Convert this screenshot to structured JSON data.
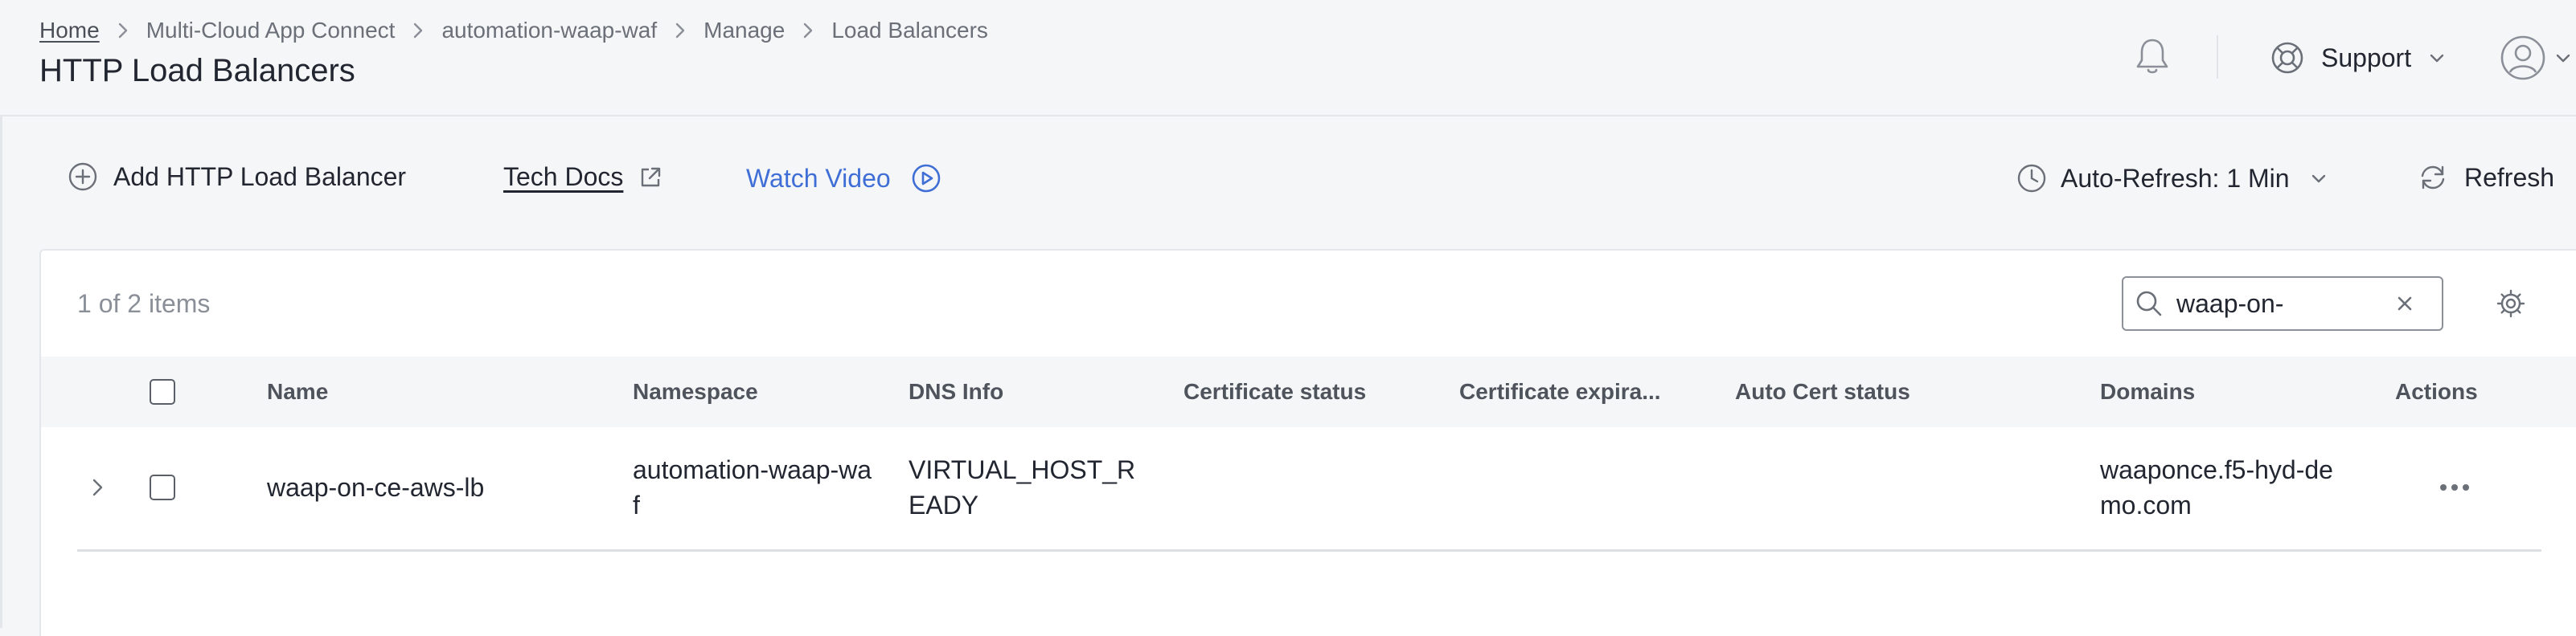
{
  "breadcrumb": {
    "items": [
      "Home",
      "Multi-Cloud App Connect",
      "automation-waap-waf",
      "Manage",
      "Load Balancers"
    ]
  },
  "page": {
    "title": "HTTP Load Balancers"
  },
  "header": {
    "support_label": "Support"
  },
  "toolbar": {
    "add_label": "Add HTTP Load Balancer",
    "tech_docs_label": "Tech Docs",
    "watch_video_label": "Watch Video",
    "auto_refresh_label": "Auto-Refresh: 1 Min",
    "refresh_label": "Refresh"
  },
  "table": {
    "count_text": "1 of 2 items",
    "search_value": "waap-on-",
    "columns": [
      "Name",
      "Namespace",
      "DNS Info",
      "Certificate status",
      "Certificate expira...",
      "Auto Cert status",
      "Domains",
      "Actions"
    ],
    "rows": [
      {
        "name": "waap-on-ce-aws-lb",
        "namespace": "automation-waap-waf",
        "dns_info": "VIRTUAL_HOST_READY",
        "certificate_status": "",
        "certificate_expiration": "",
        "auto_cert_status": "",
        "domains": "waaponce.f5-hyd-demo.com"
      }
    ]
  },
  "icons": {
    "bell": "bell-icon",
    "support": "lifebuoy-icon",
    "user": "user-circle-icon",
    "add": "plus-circle-icon",
    "external": "external-link-icon",
    "play": "play-circle-icon",
    "clock": "clock-icon",
    "refresh": "refresh-icon",
    "search": "search-icon",
    "clear": "close-icon",
    "settings": "gear-icon",
    "expand": "chevron-right-icon",
    "actions": "more-horizontal-icon"
  },
  "colors": {
    "accent": "#3f6fd6",
    "background": "#f5f6f8",
    "card": "#ffffff"
  }
}
